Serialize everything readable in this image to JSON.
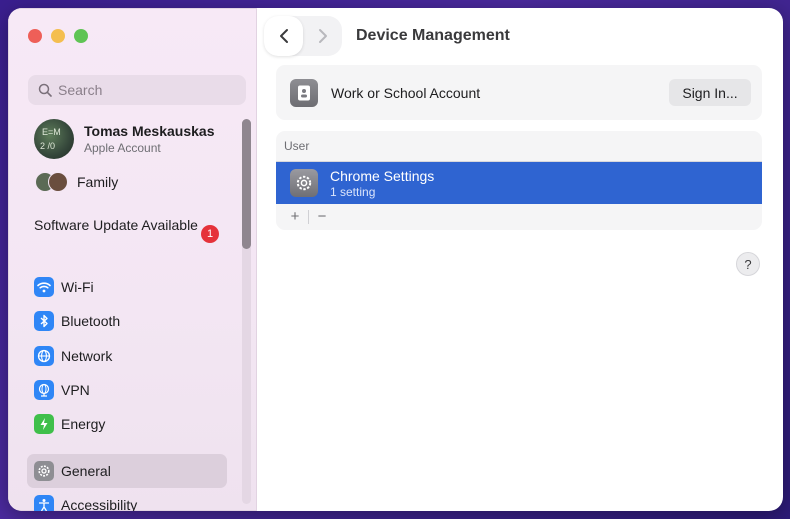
{
  "window": {
    "title": "Device Management"
  },
  "sidebar": {
    "search_placeholder": "Search",
    "account": {
      "name": "Tomas Meskauskas",
      "subtitle": "Apple Account"
    },
    "family_label": "Family",
    "software_update": {
      "label": "Software Update Available",
      "badge": "1"
    },
    "items": [
      {
        "label": "Wi-Fi",
        "icon": "wifi-icon"
      },
      {
        "label": "Bluetooth",
        "icon": "bluetooth-icon"
      },
      {
        "label": "Network",
        "icon": "globe-icon"
      },
      {
        "label": "VPN",
        "icon": "vpn-globe-icon"
      },
      {
        "label": "Energy",
        "icon": "lightning-icon"
      },
      {
        "label": "General",
        "icon": "gear-icon",
        "selected": true
      },
      {
        "label": "Accessibility",
        "icon": "accessibility-icon"
      }
    ]
  },
  "main": {
    "account_card": {
      "label": "Work or School Account",
      "button": "Sign In..."
    },
    "profiles": {
      "header": "User",
      "rows": [
        {
          "title": "Chrome Settings",
          "subtitle": "1 setting",
          "selected": true
        }
      ],
      "add": "+",
      "remove": "−"
    },
    "help": "?"
  },
  "colors": {
    "selection": "#2f64d1",
    "badge": "#e5323a",
    "accent_blue": "#2f86f6"
  }
}
